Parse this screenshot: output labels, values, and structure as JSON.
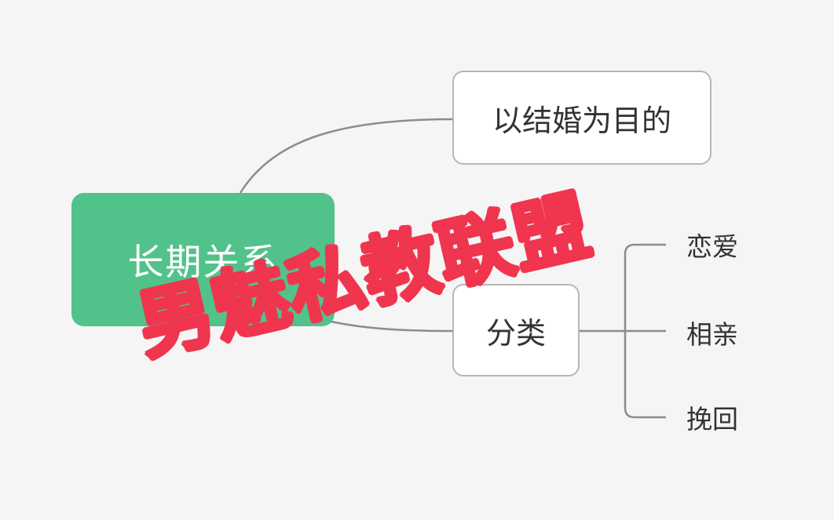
{
  "mindmap": {
    "root": {
      "label": "长期关系"
    },
    "branches": [
      {
        "label": "以结婚为目的"
      },
      {
        "label": "分类",
        "children": [
          {
            "label": "恋爱"
          },
          {
            "label": "相亲"
          },
          {
            "label": "挽回"
          }
        ]
      }
    ]
  },
  "watermark": {
    "text": "男魅私教联盟"
  },
  "colors": {
    "root_fill": "#52c28b",
    "box_border": "#b6b6b6",
    "connector": "#8c8c8c",
    "watermark": "#f0354f",
    "background": "#f5f5f5"
  }
}
